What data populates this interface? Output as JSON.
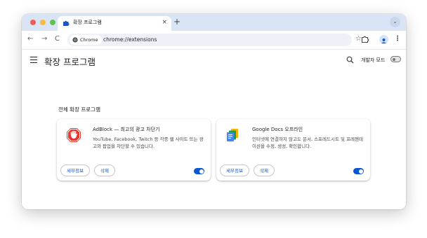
{
  "tab": {
    "title": "확장 프로그램",
    "close": "×",
    "new_tab": "+"
  },
  "tab_search_glyph": "⌄",
  "toolbar": {
    "back": "←",
    "forward": "→",
    "reload": "C",
    "chip_label": "Chrome",
    "url": "chrome://extensions",
    "star": "☆",
    "menu": "⋮"
  },
  "page": {
    "title": "확장 프로그램",
    "developer_mode_label": "개발자 모드",
    "developer_mode_on": false,
    "section_title": "전체 확장 프로그램"
  },
  "extensions": [
    {
      "name": "AdBlock — 최고의 광고 차단기",
      "description": "YouTube, Facebook, Twitch 등 각종 웹 사이트 뜨는 광고와 팝업을 차단할 수 있습니다.",
      "details_label": "세부정보",
      "remove_label": "삭제",
      "enabled": true,
      "icon": "adblock-stop-hand-icon"
    },
    {
      "name": "Google Docs 오프라인",
      "description": "인터넷에 연결하지 않고도 문서, 스프레드시트 및 프레젠테이션을 수정, 생성, 확인합니다.",
      "details_label": "세부정보",
      "remove_label": "삭제",
      "enabled": true,
      "icon": "google-docs-offline-icon"
    }
  ],
  "colors": {
    "accent": "#0b57d0",
    "tabstrip": "#d9e4f5",
    "adblock_red": "#e8372c"
  }
}
